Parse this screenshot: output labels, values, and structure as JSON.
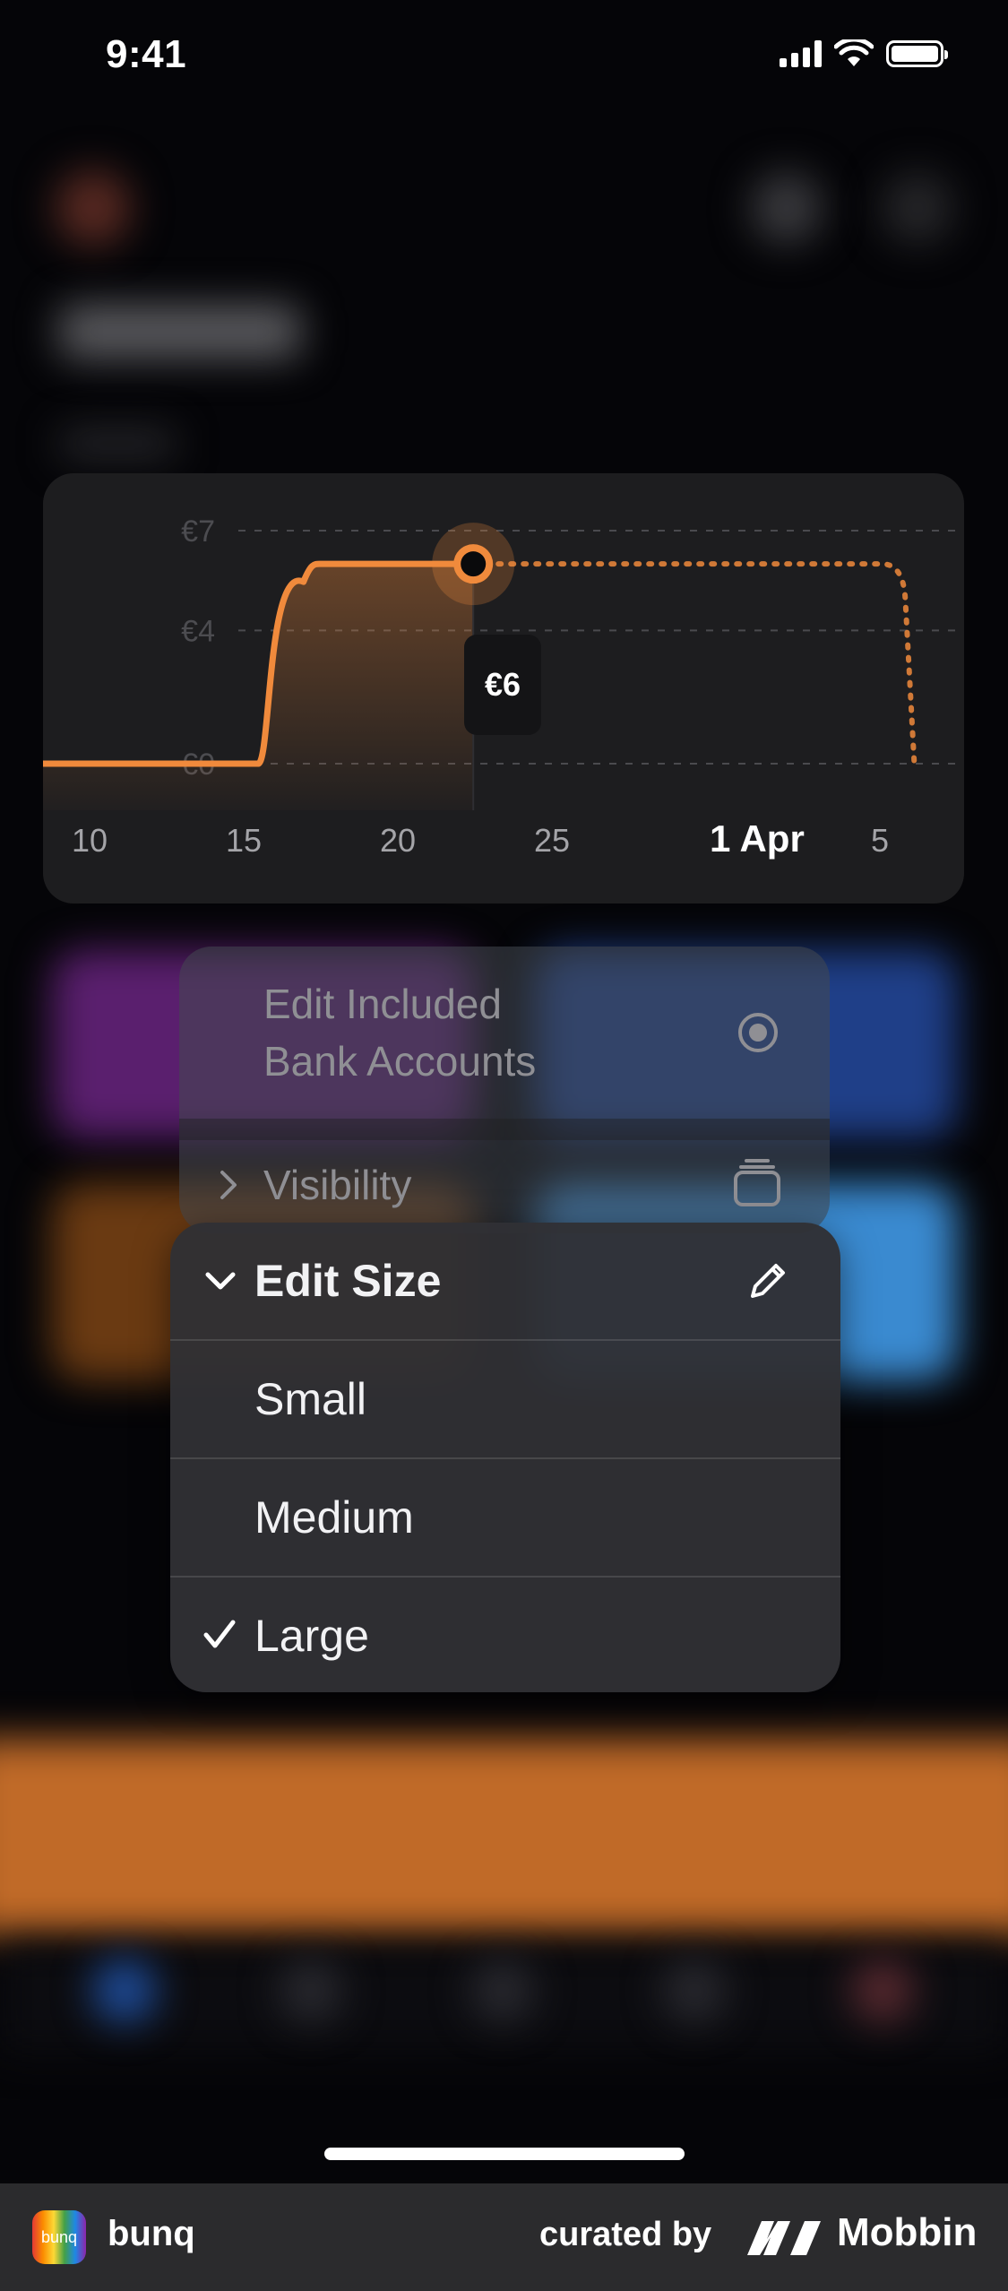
{
  "status_bar": {
    "time": "9:41"
  },
  "chart_card": {
    "tooltip": "€6",
    "current_date_label": "1 Apr",
    "chart_data": {
      "type": "line",
      "y_ticks": [
        "€7",
        "€4",
        "€0"
      ],
      "x_ticks": [
        "10",
        "15",
        "20",
        "25",
        "1 Apr",
        "5"
      ],
      "series": [
        {
          "x": [
            "10 Mar",
            "17 Mar",
            "19 Mar",
            "24 Mar"
          ],
          "values": [
            0,
            0,
            6,
            6
          ]
        }
      ],
      "projection": {
        "x": [
          "24 Mar",
          "7 Apr"
        ],
        "values": [
          6,
          6
        ]
      },
      "ylim": [
        0,
        7
      ],
      "selected_point": {
        "x": "24 Mar",
        "value": 6
      },
      "line_color": "#f08a3c",
      "grid": true
    }
  },
  "context_menu_back": {
    "items": [
      {
        "label": "Edit Included\nBank Accounts",
        "icon": "target-icon"
      },
      {
        "label": "Visibility",
        "icon": "stack-icon"
      }
    ]
  },
  "context_menu": {
    "header": {
      "label": "Edit Size",
      "icon": "pencil-icon"
    },
    "options": [
      {
        "label": "Small",
        "checked": false
      },
      {
        "label": "Medium",
        "checked": false
      },
      {
        "label": "Large",
        "checked": true
      }
    ]
  },
  "footer": {
    "app_name": "bunq",
    "curated_by": "curated by",
    "brand": "Mobbin"
  },
  "colors": {
    "accent": "#f08a3c",
    "background": "#050508",
    "card": "#1d1d1f"
  }
}
